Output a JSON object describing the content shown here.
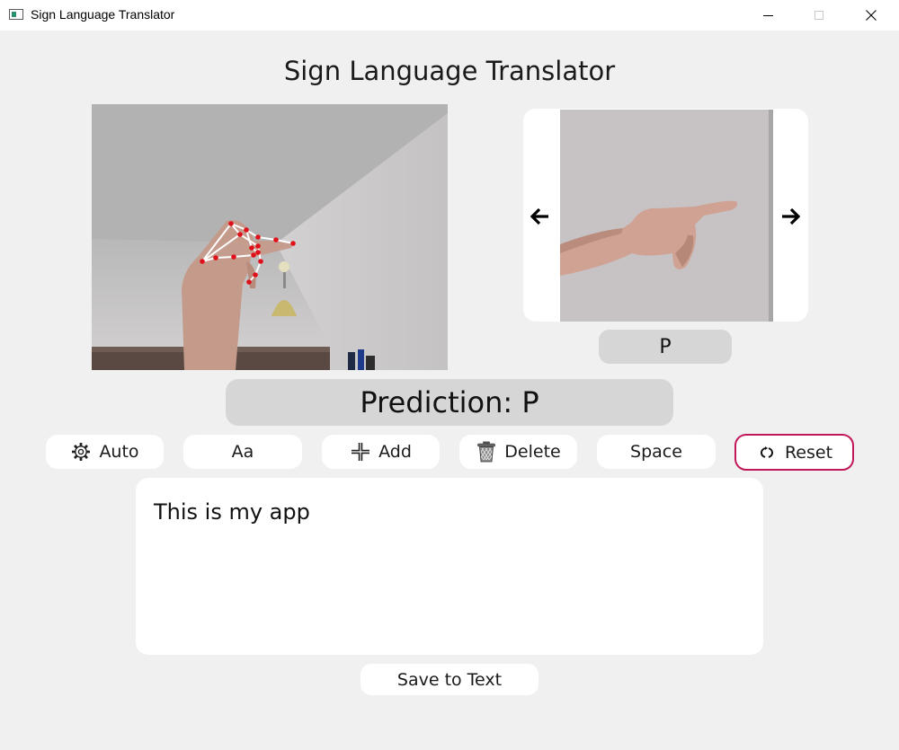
{
  "window": {
    "title": "Sign Language Translator"
  },
  "header": {
    "title": "Sign Language Translator"
  },
  "reference": {
    "letter": "P"
  },
  "prediction": {
    "text": "Prediction: P"
  },
  "toolbar": {
    "auto_label": "Auto",
    "case_label": "Aa",
    "add_label": "Add",
    "delete_label": "Delete",
    "space_label": "Space",
    "reset_label": "Reset"
  },
  "output": {
    "text": "This is my app"
  },
  "save": {
    "label": "Save to Text"
  },
  "colors": {
    "reset_border": "#c2185b",
    "landmark": "#e0101a"
  },
  "icons": [
    "app-icon",
    "minimize-icon",
    "maximize-icon",
    "close-icon",
    "arrow-left-icon",
    "arrow-right-icon",
    "gear-icon",
    "plus-icon",
    "trash-icon",
    "reset-icon"
  ]
}
